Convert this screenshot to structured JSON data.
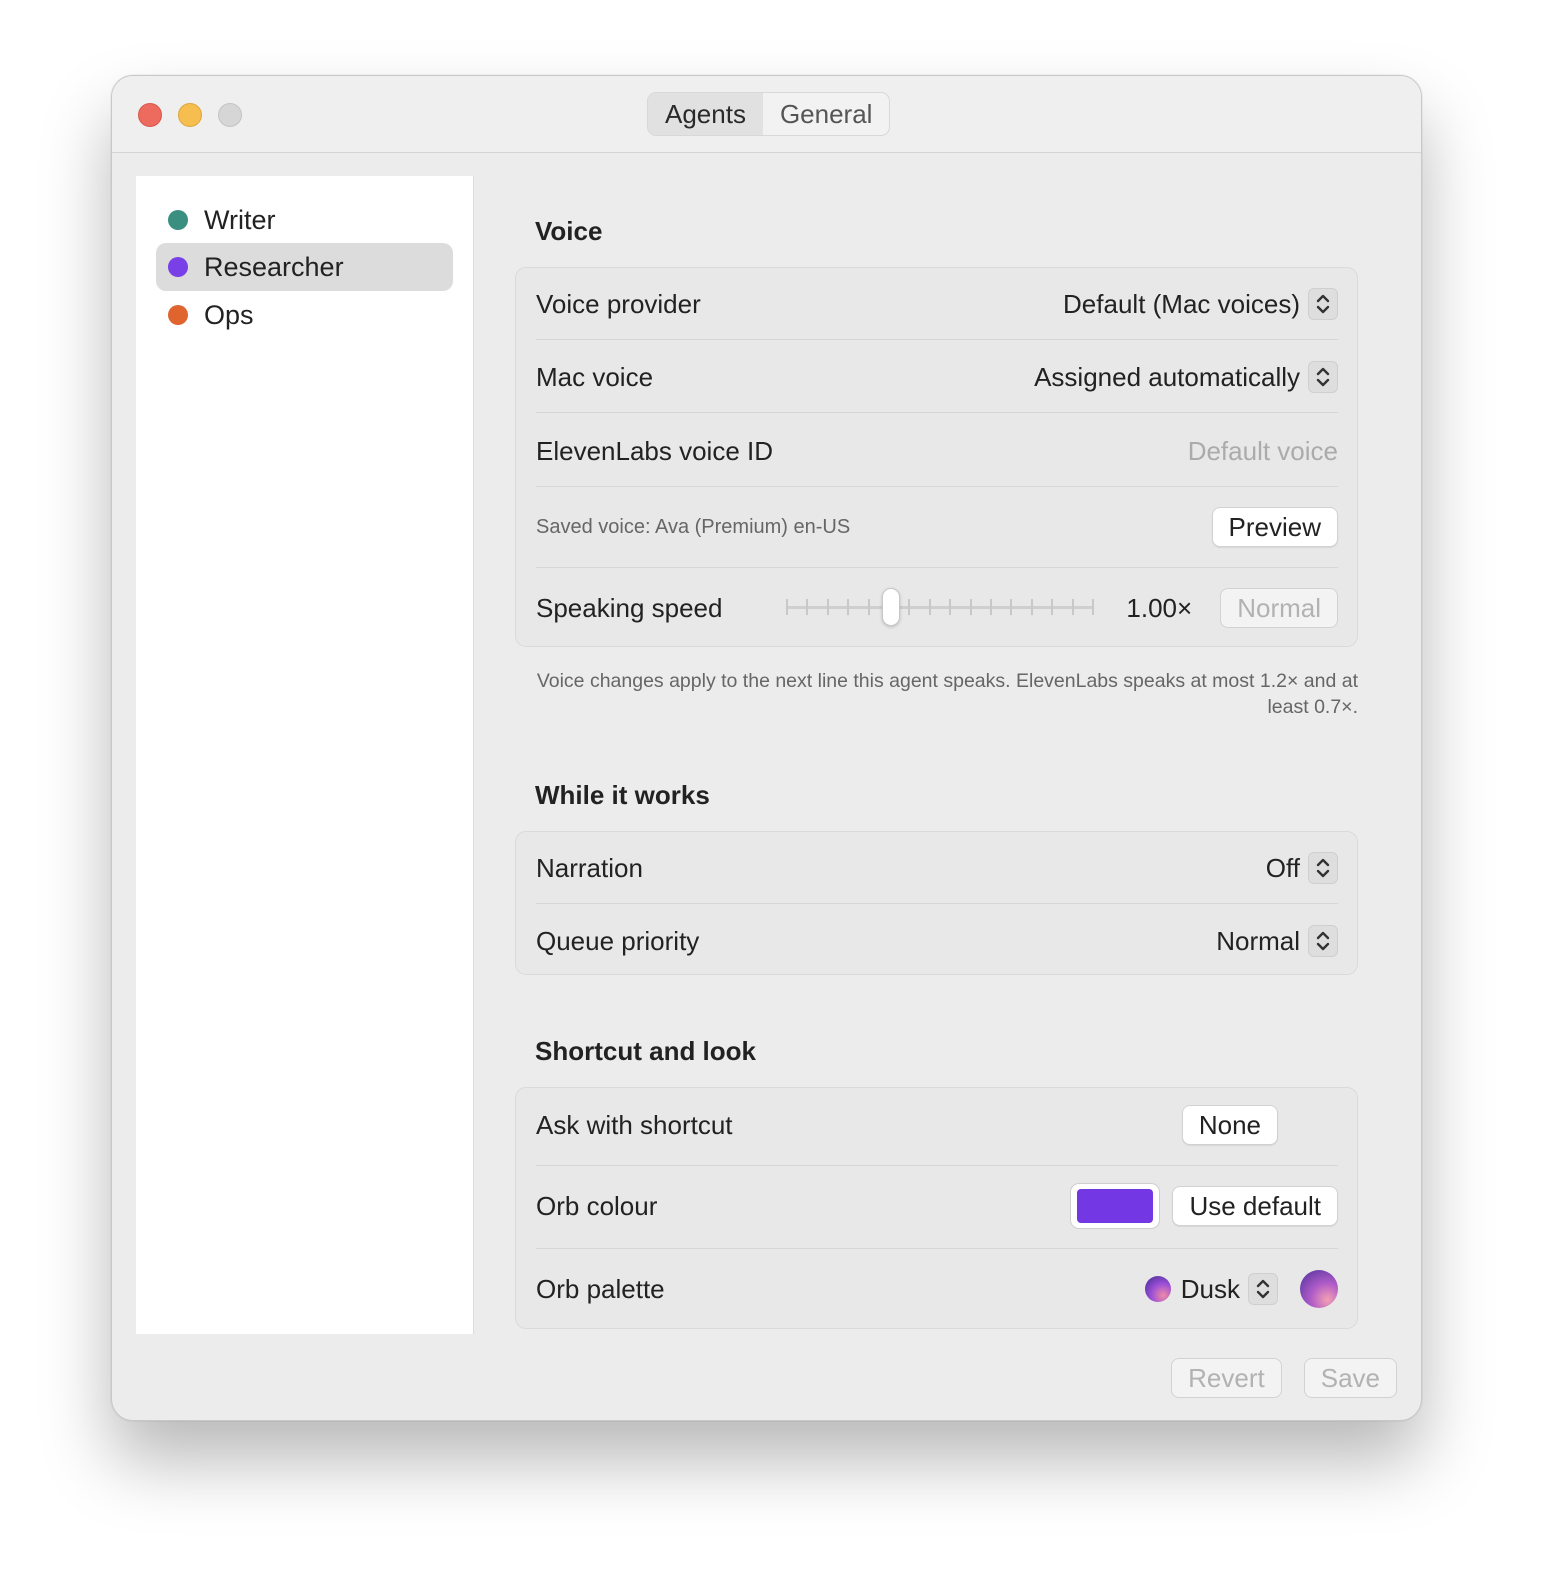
{
  "tabs": [
    {
      "label": "Agents",
      "active": true
    },
    {
      "label": "General",
      "active": false
    }
  ],
  "sidebar": {
    "items": [
      {
        "label": "Writer",
        "color": "#3b8f80",
        "selected": false
      },
      {
        "label": "Researcher",
        "color": "#7840e6",
        "selected": true
      },
      {
        "label": "Ops",
        "color": "#e0642e",
        "selected": false
      }
    ]
  },
  "voice": {
    "title": "Voice",
    "provider_label": "Voice provider",
    "provider_value": "Default (Mac voices)",
    "mac_voice_label": "Mac voice",
    "mac_voice_value": "Assigned automatically",
    "elevenlabs_label": "ElevenLabs voice ID",
    "elevenlabs_placeholder": "Default voice",
    "saved_voice": "Saved voice: Ava (Premium) en-US",
    "preview_label": "Preview",
    "speed_label": "Speaking speed",
    "speed_value": "1.00×",
    "speed_fraction": 0.34,
    "speed_normal_label": "Normal",
    "note": "Voice changes apply to the next line this agent speaks. ElevenLabs speaks at most 1.2× and at least 0.7×."
  },
  "work": {
    "title": "While it works",
    "narration_label": "Narration",
    "narration_value": "Off",
    "queue_label": "Queue priority",
    "queue_value": "Normal"
  },
  "look": {
    "title": "Shortcut and look",
    "shortcut_label": "Ask with shortcut",
    "shortcut_value": "None",
    "orb_colour_label": "Orb colour",
    "orb_colour": "#7338e4",
    "use_default_label": "Use default",
    "orb_palette_label": "Orb palette",
    "orb_palette_value": "Dusk"
  },
  "footer": {
    "revert_label": "Revert",
    "save_label": "Save"
  }
}
